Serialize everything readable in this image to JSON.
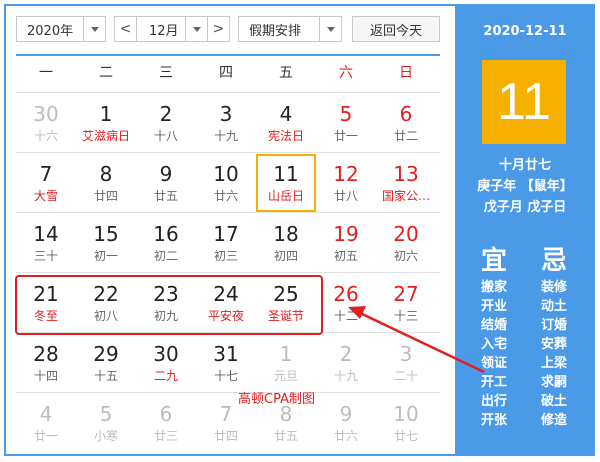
{
  "toolbar": {
    "year": "2020年",
    "month": "12月",
    "holiday": "假期安排",
    "today": "返回今天",
    "prev": "<",
    "next": ">"
  },
  "weekdays": [
    "一",
    "二",
    "三",
    "四",
    "五",
    "六",
    "日"
  ],
  "weeks": [
    [
      {
        "n": "30",
        "s": "十六",
        "o": true
      },
      {
        "n": "1",
        "s": "艾滋病日",
        "f": true
      },
      {
        "n": "2",
        "s": "十八"
      },
      {
        "n": "3",
        "s": "十九"
      },
      {
        "n": "4",
        "s": "宪法日",
        "f": true
      },
      {
        "n": "5",
        "s": "廿一"
      },
      {
        "n": "6",
        "s": "廿二"
      }
    ],
    [
      {
        "n": "7",
        "s": "大雪",
        "f": true
      },
      {
        "n": "8",
        "s": "廿四"
      },
      {
        "n": "9",
        "s": "廿五"
      },
      {
        "n": "10",
        "s": "廿六"
      },
      {
        "n": "11",
        "s": "山岳日",
        "f": true,
        "sel": true
      },
      {
        "n": "12",
        "s": "廿八"
      },
      {
        "n": "13",
        "s": "国家公…",
        "f": true
      }
    ],
    [
      {
        "n": "14",
        "s": "三十"
      },
      {
        "n": "15",
        "s": "初一"
      },
      {
        "n": "16",
        "s": "初二"
      },
      {
        "n": "17",
        "s": "初三"
      },
      {
        "n": "18",
        "s": "初四"
      },
      {
        "n": "19",
        "s": "初五"
      },
      {
        "n": "20",
        "s": "初六"
      }
    ],
    [
      {
        "n": "21",
        "s": "冬至",
        "f": true
      },
      {
        "n": "22",
        "s": "初八"
      },
      {
        "n": "23",
        "s": "初九"
      },
      {
        "n": "24",
        "s": "平安夜",
        "f": true
      },
      {
        "n": "25",
        "s": "圣诞节",
        "f": true
      },
      {
        "n": "26",
        "s": "十二"
      },
      {
        "n": "27",
        "s": "十三"
      }
    ],
    [
      {
        "n": "28",
        "s": "十四"
      },
      {
        "n": "29",
        "s": "十五"
      },
      {
        "n": "30",
        "s": "二九",
        "f": true
      },
      {
        "n": "31",
        "s": "十七"
      },
      {
        "n": "1",
        "s": "元旦",
        "o": true
      },
      {
        "n": "2",
        "s": "十九",
        "o": true
      },
      {
        "n": "3",
        "s": "二十",
        "o": true
      }
    ],
    [
      {
        "n": "4",
        "s": "廿一",
        "o": true
      },
      {
        "n": "5",
        "s": "小寒",
        "o": true
      },
      {
        "n": "6",
        "s": "廿三",
        "o": true
      },
      {
        "n": "7",
        "s": "廿四",
        "o": true
      },
      {
        "n": "8",
        "s": "廿五",
        "o": true
      },
      {
        "n": "9",
        "s": "廿六",
        "o": true
      },
      {
        "n": "10",
        "s": "廿七",
        "o": true
      }
    ]
  ],
  "panel": {
    "date": "2020-12-11",
    "day": "11",
    "lunar": "十月廿七",
    "year_gz": "庚子年 【鼠年】",
    "month_day_gz": "戊子月 戊子日",
    "yi_title": "宜",
    "ji_title": "忌",
    "yi": [
      "搬家",
      "开业",
      "结婚",
      "入宅",
      "领证",
      "开工",
      "出行",
      "开张"
    ],
    "ji": [
      "装修",
      "动土",
      "订婚",
      "安葬",
      "上梁",
      "求嗣",
      "破土",
      "修造"
    ]
  },
  "annotation": {
    "label": "高顿CPA制图"
  },
  "colors": {
    "accent": "#4a9ae8",
    "highlight": "#f5b000",
    "weekend": "#e02020"
  }
}
